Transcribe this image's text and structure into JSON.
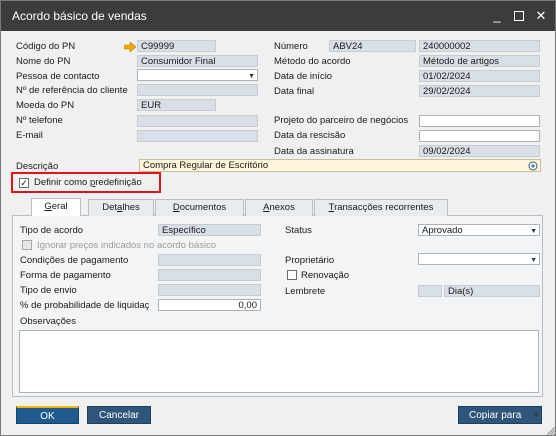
{
  "window": {
    "title": "Acordo básico de vendas",
    "controls": {
      "minimize": "_",
      "close": "✕"
    }
  },
  "header": {
    "left": [
      {
        "label": "Código do PN",
        "value": "C99999"
      },
      {
        "label": "Nome do PN",
        "value": "Consumidor Final"
      },
      {
        "label": "Pessoa de contacto",
        "value": ""
      },
      {
        "label": "Nº de referência do cliente",
        "value": ""
      },
      {
        "label": "Moeda do PN",
        "value": "EUR"
      },
      {
        "label": "Nº telefone",
        "value": ""
      },
      {
        "label": "E-mail",
        "value": ""
      }
    ],
    "right": [
      {
        "label": "Número",
        "series": "ABV24",
        "value": "240000002"
      },
      {
        "label": "Método do acordo",
        "value": "Método de artigos"
      },
      {
        "label": "Data de início",
        "value": "01/02/2024"
      },
      {
        "label": "Data final",
        "value": "29/02/2024"
      },
      {
        "label": "Projeto do parceiro de negócios",
        "value": ""
      },
      {
        "label": "Data da rescisão",
        "value": ""
      },
      {
        "label": "Data da assinatura",
        "value": "09/02/2024"
      }
    ],
    "description": {
      "label": "Descrição",
      "value": "Compra Regular de Escritório"
    },
    "default_checkbox": {
      "label_before": "Definir como ",
      "label_underlined": "p",
      "label_after": "redefinição",
      "checked": true,
      "check_glyph": "✓"
    }
  },
  "tabs": [
    {
      "pre": "",
      "u": "G",
      "post": "eral",
      "active": true
    },
    {
      "pre": "Det",
      "u": "a",
      "post": "lhes",
      "active": false
    },
    {
      "pre": "",
      "u": "D",
      "post": "ocumentos",
      "active": false
    },
    {
      "pre": "",
      "u": "A",
      "post": "nexos",
      "active": false
    },
    {
      "pre": "",
      "u": "T",
      "post": "ransacções recorrentes",
      "active": false
    }
  ],
  "general": {
    "left": {
      "agreement_type": {
        "label": "Tipo de acordo",
        "value": "Específico"
      },
      "ignore_prices": {
        "label": "Ignorar preços indicados no acordo básico",
        "checked": false
      },
      "payment_terms": {
        "label": "Condições de pagamento",
        "value": ""
      },
      "payment_method": {
        "label": "Forma de pagamento",
        "value": ""
      },
      "shipping_type": {
        "label": "Tipo de envio",
        "value": ""
      },
      "probability": {
        "label": "% de probabilidade de liquidaç",
        "value": "0,00"
      }
    },
    "right": {
      "status": {
        "label": "Status",
        "value": "Aprovado"
      },
      "owner": {
        "label": "Proprietário",
        "value": ""
      },
      "renewal": {
        "label": "Renovação",
        "checked": false
      },
      "reminder": {
        "label": "Lembrete",
        "value": "",
        "unit": "Dia(s)"
      }
    },
    "observations": {
      "label": "Observações",
      "value": ""
    }
  },
  "footer": {
    "ok": "OK",
    "cancel": "Cancelar",
    "copy_to": "Copiar para"
  },
  "colors": {
    "titlebar": "#3c3c3c",
    "highlight": "#e0141e",
    "link_arrow": "#f0a800",
    "button": "#30557b",
    "button_accent": "#f0b400"
  }
}
